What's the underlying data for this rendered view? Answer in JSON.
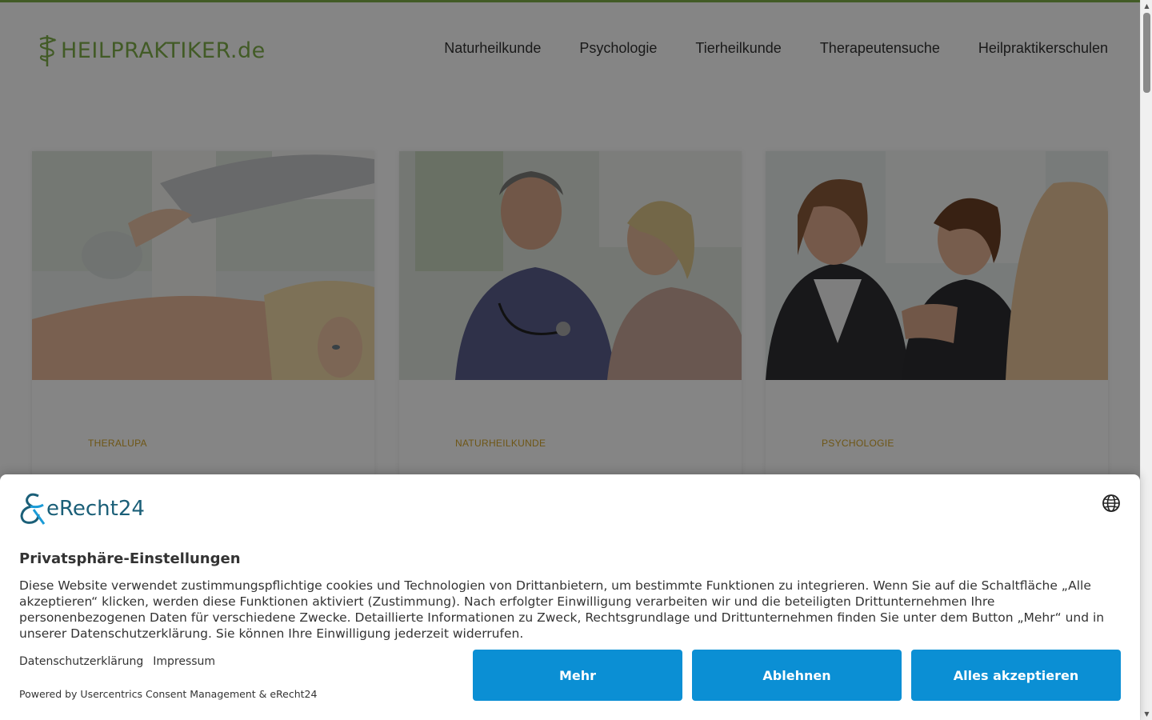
{
  "brand": {
    "logo_text": "HEILPRAKTIKER",
    "logo_tld": ".de",
    "accent_color": "#7fae4a"
  },
  "nav": {
    "items": [
      {
        "label": "Naturheilkunde"
      },
      {
        "label": "Psychologie"
      },
      {
        "label": "Tierheilkunde"
      },
      {
        "label": "Therapeutensuche"
      },
      {
        "label": "Heilpraktikerschulen"
      }
    ]
  },
  "cards": [
    {
      "category": "THERALUPA",
      "image": "cupping-therapy-photo"
    },
    {
      "category": "NATURHEILKUNDE",
      "image": "doctor-consultation-photo"
    },
    {
      "category": "PSYCHOLOGIE",
      "image": "counseling-session-photo"
    }
  ],
  "consent": {
    "provider_logo": "eRecht24",
    "language_icon": "globe-icon",
    "title": "Privatsphäre-Einstellungen",
    "description": "Diese Website verwendet zustimmungspflichtige cookies und Technologien von Drittanbietern, um bestimmte Funktionen zu integrieren. Wenn Sie auf die Schaltfläche „Alle akzeptieren“ klicken, werden diese Funktionen aktiviert (Zustimmung). Nach erfolgter Einwilligung verarbeiten wir und die beteiligten Drittunternehmen Ihre personenbezogenen Daten für verschiedene Zwecke. Detaillierte Informationen zu Zweck, Rechtsgrundlage und Drittunternehmen finden Sie unter dem Button „Mehr“ und in unserer Datenschutzerklärung. Sie können Ihre Einwilligung jederzeit widerrufen.",
    "links": {
      "privacy": "Datenschutzerklärung",
      "imprint": "Impressum"
    },
    "powered_by": "Powered by Usercentrics Consent Management & eRecht24",
    "buttons": {
      "more": "Mehr",
      "deny": "Ablehnen",
      "accept_all": "Alles akzeptieren"
    },
    "button_color": "#0b8fd4"
  }
}
